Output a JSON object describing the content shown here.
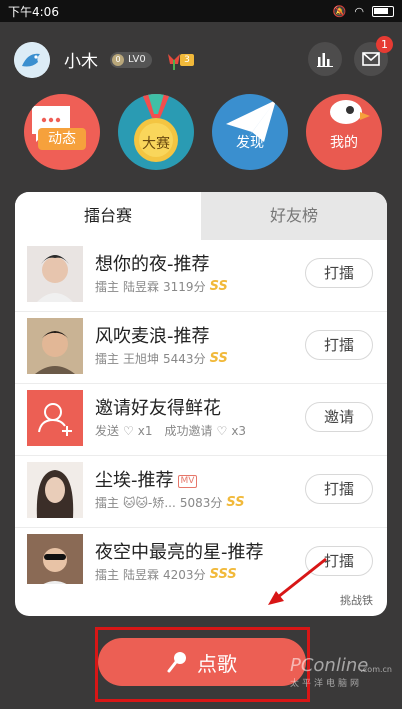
{
  "status_bar": {
    "time": "下午4:06"
  },
  "header": {
    "user_name": "小木",
    "level": "LV0",
    "level_coin": "0",
    "flower_count": "3",
    "notification_count": "1"
  },
  "categories": [
    {
      "label": "动态",
      "color": "#ef5f56"
    },
    {
      "label": "大赛",
      "color": "#2a9bb3"
    },
    {
      "label": "发现",
      "color": "#3a8fcf"
    },
    {
      "label": "我的",
      "color": "#e95a50"
    }
  ],
  "tabs": {
    "active": "擂台赛",
    "inactive": "好友榜"
  },
  "rows": [
    {
      "title": "想你的夜-推荐",
      "meta_prefix": "擂主",
      "owner": "陆昱霖",
      "score": "3119分",
      "grade": "SS",
      "action": "打擂"
    },
    {
      "title": "风吹麦浪-推荐",
      "meta_prefix": "擂主",
      "owner": "王旭坤",
      "score": "5443分",
      "grade": "SS",
      "action": "打擂"
    },
    {
      "title": "邀请好友得鲜花",
      "meta_prefix": "发送",
      "send_count": "x1",
      "success_label": "成功邀请",
      "success_count": "x3",
      "action": "邀请"
    },
    {
      "title": "尘埃-推荐",
      "mv": "MV",
      "meta_prefix": "擂主",
      "owner": "🐱🐱-矫...",
      "score": "5083分",
      "grade": "SS",
      "action": "打擂"
    },
    {
      "title": "夜空中最亮的星-推荐",
      "meta_prefix": "擂主",
      "owner": "陆昱霖",
      "score": "4203分",
      "grade": "SSS",
      "action": "打擂"
    }
  ],
  "footer_link": "挑战铁",
  "sing_button": "点歌",
  "watermark": {
    "brand": "PConline",
    "sub": "太平洋电脑网",
    "domain": ".com.cn"
  }
}
